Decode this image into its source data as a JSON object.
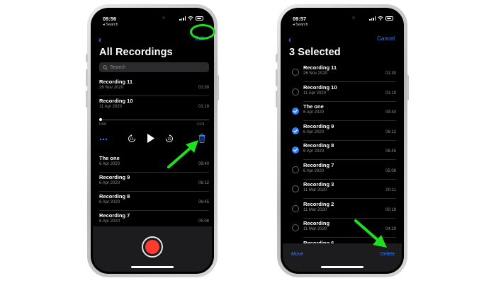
{
  "left_phone": {
    "status": {
      "time": "09:56",
      "back_label": "◂ Search"
    },
    "nav": {
      "edit_label": "Edit"
    },
    "title": "All Recordings",
    "search": {
      "placeholder": "Search"
    },
    "recordings_top": [
      {
        "name": "Recording 11",
        "date": "26 Nov 2020",
        "duration": "01:30"
      },
      {
        "name": "Recording 10",
        "date": "11 Apr 2020",
        "duration": "01:19"
      }
    ],
    "playback": {
      "elapsed": "0:00",
      "remaining": "-1:19",
      "progress": 0.0
    },
    "recordings_bottom": [
      {
        "name": "The one",
        "date": "6 Apr 2020",
        "duration": "09:40"
      },
      {
        "name": "Recording 9",
        "date": "6 Apr 2020",
        "duration": "06:12"
      },
      {
        "name": "Recording 8",
        "date": "6 Apr 2020",
        "duration": "06:45"
      },
      {
        "name": "Recording 7",
        "date": "6 Apr 2020",
        "duration": "05:08"
      }
    ]
  },
  "right_phone": {
    "status": {
      "time": "09:57",
      "back_label": "◂ Search"
    },
    "nav": {
      "cancel_label": "Cancel"
    },
    "title": "3 Selected",
    "recordings": [
      {
        "name": "Recording 11",
        "date": "26 Nov 2020",
        "duration": "01:30",
        "selected": false
      },
      {
        "name": "Recording 10",
        "date": "11 Apr 2020",
        "duration": "01:19",
        "selected": false
      },
      {
        "name": "The one",
        "date": "6 Apr 2020",
        "duration": "09:40",
        "selected": true
      },
      {
        "name": "Recording 9",
        "date": "6 Apr 2020",
        "duration": "06:12",
        "selected": true
      },
      {
        "name": "Recording 8",
        "date": "6 Apr 2020",
        "duration": "06:45",
        "selected": true
      },
      {
        "name": "Recording 7",
        "date": "6 Apr 2020",
        "duration": "05:08",
        "selected": false
      },
      {
        "name": "Recording 3",
        "date": "11 Mar 2020",
        "duration": "00:11",
        "selected": false
      },
      {
        "name": "Recording 2",
        "date": "11 Mar 2020",
        "duration": "00:18",
        "selected": false
      },
      {
        "name": "Recording",
        "date": "11 Mar 2020",
        "duration": "04:29",
        "selected": false
      },
      {
        "name": "Recording 6",
        "date": "6 Nov 2019",
        "duration": "01:03",
        "selected": false
      }
    ],
    "toolbar": {
      "move_label": "Move",
      "delete_label": "Delete"
    }
  },
  "colors": {
    "accent": "#2f7dff",
    "record": "#ff3b30",
    "annotation": "#1ee01e",
    "background": "#000000"
  },
  "icons": {
    "back": "chevron-left-icon",
    "search": "magnifier-icon",
    "more": "ellipsis-icon",
    "skip_back": "skip-back-15-icon",
    "play": "play-icon",
    "skip_forward": "skip-forward-15-icon",
    "delete": "trash-icon",
    "selected": "checkmark-circle-icon"
  }
}
